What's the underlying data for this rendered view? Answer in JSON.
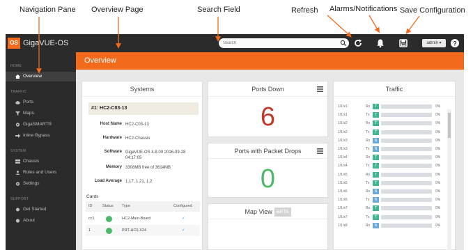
{
  "callouts": {
    "navigation_pane": "Navigation Pane",
    "overview_page": "Overview Page",
    "search_field": "Search Field",
    "refresh": "Refresh",
    "alarms": "Alarms/Notifications",
    "save_config": "Save Configuration"
  },
  "topbar": {
    "logo": "OS",
    "brand": "GigaVUE-OS",
    "search_placeholder": "Search",
    "user_menu": "admin ▾",
    "icons": [
      "search-icon",
      "refresh-icon",
      "bell-icon",
      "save-icon",
      "help-icon"
    ]
  },
  "sidebar": {
    "sections": [
      {
        "label": "HOME",
        "items": [
          {
            "label": "Overview",
            "icon": "home-icon",
            "active": true
          }
        ]
      },
      {
        "label": "TRAFFIC",
        "items": [
          {
            "label": "Ports",
            "icon": "cloud-icon"
          },
          {
            "label": "Maps",
            "icon": "filter-icon"
          },
          {
            "label": "GigaSMART®",
            "icon": "gear-icon"
          },
          {
            "label": "Inline Bypass",
            "icon": "arrow-icon"
          }
        ]
      },
      {
        "label": "SYSTEM",
        "items": [
          {
            "label": "Chassis",
            "icon": "chassis-icon"
          },
          {
            "label": "Roles and Users",
            "icon": "user-icon"
          },
          {
            "label": "Settings",
            "icon": "gear-icon"
          }
        ]
      },
      {
        "label": "SUPPORT",
        "items": [
          {
            "label": "Get Started",
            "icon": "rocket-icon"
          },
          {
            "label": "About",
            "icon": "info-icon"
          }
        ]
      }
    ]
  },
  "banner": {
    "title": "Overview"
  },
  "systems": {
    "title": "Systems",
    "system_name": "#1: HC2-C03-13",
    "fields": {
      "host_name_label": "Host Name",
      "host_name": "HC2-C03-13",
      "hardware_label": "Hardware",
      "hardware": "HC2-Chassis",
      "software_label": "Software",
      "software": "GigaVUE-OS 4.8.00 2016-09-28 04:17:05",
      "memory_label": "Memory",
      "memory": "3308MB free of 3614MB",
      "load_label": "Load Average",
      "load": "1.17, 1.21, 1.2"
    },
    "cards_label": "Cards",
    "cards_headers": {
      "id": "ID",
      "status": "Status",
      "type": "Type",
      "configured": "Configured"
    },
    "cards_rows": [
      {
        "id": "cc1",
        "type": "HC2-Main-Board",
        "configured": "✓"
      },
      {
        "id": "1",
        "type": "PRT-HC0-X24",
        "configured": "✓"
      }
    ]
  },
  "ports_down": {
    "title": "Ports Down",
    "value": "6",
    "color": "#c0392b"
  },
  "packet_drops": {
    "title": "Ports with Packet Drops",
    "value": "0",
    "color": "#4cb86a"
  },
  "map_view": {
    "title": "Map View",
    "badge": "BETA"
  },
  "traffic": {
    "title": "Traffic",
    "colors": {
      "rx": "#3fb88d",
      "tx": "#6aa9d8"
    },
    "rows": [
      {
        "port": "1/1/x1",
        "dir": "Rx",
        "badge": "T",
        "kind": "rx",
        "pct": "0%",
        "fill": 0
      },
      {
        "port": "1/1/x1",
        "dir": "Tx",
        "badge": "T",
        "kind": "rx",
        "pct": "0%",
        "fill": 0
      },
      {
        "port": "1/1/x2",
        "dir": "Rx",
        "badge": "T",
        "kind": "rx",
        "pct": "0%",
        "fill": 0
      },
      {
        "port": "1/1/x2",
        "dir": "Tx",
        "badge": "T",
        "kind": "rx",
        "pct": "0%",
        "fill": 0
      },
      {
        "port": "1/1/x3",
        "dir": "Rx",
        "badge": "N",
        "kind": "tx",
        "pct": "0%",
        "fill": 0
      },
      {
        "port": "1/1/x3",
        "dir": "Tx",
        "badge": "N",
        "kind": "tx",
        "pct": "0%",
        "fill": 0
      },
      {
        "port": "1/1/x4",
        "dir": "Rx",
        "badge": "T",
        "kind": "rx",
        "pct": "0%",
        "fill": 0
      },
      {
        "port": "1/1/x4",
        "dir": "Tx",
        "badge": "T",
        "kind": "rx",
        "pct": "0%",
        "fill": 0
      },
      {
        "port": "1/1/x5",
        "dir": "Rx",
        "badge": "T",
        "kind": "rx",
        "pct": "0%",
        "fill": 0
      },
      {
        "port": "1/1/x5",
        "dir": "Tx",
        "badge": "T",
        "kind": "rx",
        "pct": "0%",
        "fill": 0
      },
      {
        "port": "1/1/x6",
        "dir": "Rx",
        "badge": "N",
        "kind": "tx",
        "pct": "0%",
        "fill": 0
      },
      {
        "port": "1/1/x6",
        "dir": "Tx",
        "badge": "N",
        "kind": "tx",
        "pct": "0%",
        "fill": 0
      },
      {
        "port": "1/1/x7",
        "dir": "Rx",
        "badge": "T",
        "kind": "rx",
        "pct": "0%",
        "fill": 0
      },
      {
        "port": "1/1/x7",
        "dir": "Tx",
        "badge": "T",
        "kind": "rx",
        "pct": "0%",
        "fill": 0
      },
      {
        "port": "1/1/x8",
        "dir": "Rx",
        "badge": "N",
        "kind": "tx",
        "pct": "0%",
        "fill": 0
      }
    ]
  }
}
